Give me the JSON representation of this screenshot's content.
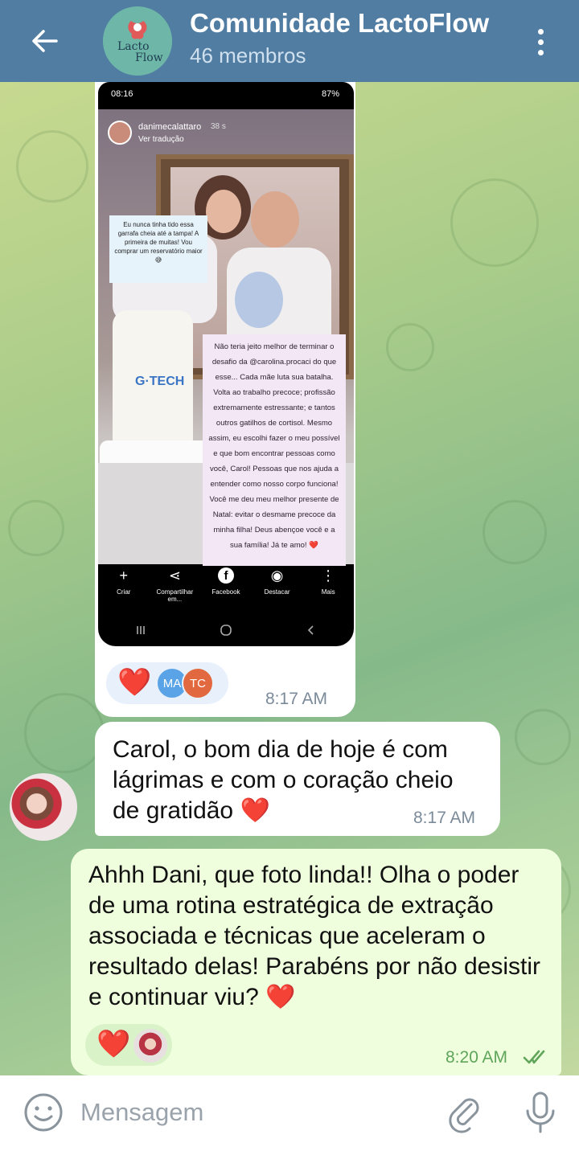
{
  "header": {
    "title": "Comunidade LactoFlow",
    "subtitle": "46 membros",
    "avatar_logo_line1": "Lacto",
    "avatar_logo_line2": "Flow"
  },
  "story": {
    "status_time": "08:16",
    "status_battery": "87%",
    "username": "danimecalattaro",
    "time_ago": "38 s",
    "translate_label": "Ver tradução",
    "bottle_brand": "G·TECH",
    "sticker_small": "Eu nunca tinha tido essa garrafa cheia até a tampa! A primeira de muitas! Vou comprar um reservatório maior 😅",
    "sticker_big": "Não teria jeito melhor de terminar o desafio da @carolina.procaci do que esse... Cada mãe luta sua batalha. Volta ao trabalho precoce; profissão extremamente estressante; e tantos outros gatilhos de cortisol. Mesmo assim, eu escolhi fazer o meu possível e que bom encontrar pessoas como você, Carol! Pessoas que nos ajuda a entender como nosso corpo funciona! Você me deu meu melhor presente de Natal: evitar o desmame precoce da minha filha! Deus abençoe você e a sua família! Já te amo! ❤️",
    "actions": [
      {
        "label": "Criar",
        "icon": "plus-icon",
        "glyph": "+"
      },
      {
        "label": "Compartilhar em...",
        "icon": "share-icon",
        "glyph": "⋖"
      },
      {
        "label": "Facebook",
        "icon": "facebook-icon",
        "glyph": "f"
      },
      {
        "label": "Destacar",
        "icon": "highlight-icon",
        "glyph": "◉"
      },
      {
        "label": "Mais",
        "icon": "more-vertical-icon",
        "glyph": "⋮"
      }
    ]
  },
  "messages": {
    "photo": {
      "reaction": "❤️",
      "reactor_1": "MA",
      "reactor_2": "TC",
      "time": "8:17 AM"
    },
    "incoming": {
      "text": "Carol, o bom dia de hoje é com lágrimas e com o coração cheio de gratidão ❤️",
      "time": "8:17 AM"
    },
    "outgoing": {
      "text": "Ahhh Dani, que foto linda!! Olha o poder de uma rotina estratégica de extração associada e técnicas que aceleram o resultado delas! Parabéns por não desistir e continuar viu? ❤️",
      "reaction": "❤️",
      "time": "8:20 AM"
    }
  },
  "input": {
    "placeholder": "Mensagem"
  },
  "colors": {
    "header": "#517da2",
    "outgoing_bubble": "#effedd",
    "incoming_bubble": "#ffffff",
    "heart": "#e01c1c"
  }
}
